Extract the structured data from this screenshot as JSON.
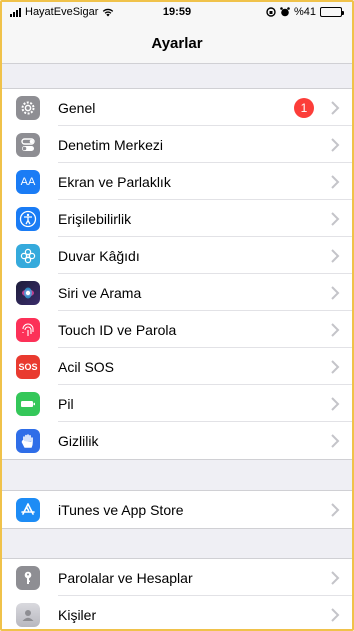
{
  "status_bar": {
    "carrier": "HayatEveSigar",
    "time": "19:59",
    "battery_text": "%41",
    "battery_level": 0.41
  },
  "nav": {
    "title": "Ayarlar"
  },
  "colors": {
    "general": "#8e8e93",
    "control_center": "#8e8e93",
    "display": "#1a7cf5",
    "accessibility": "#1a7cf5",
    "wallpaper": "#35aadc",
    "siri": "#1d1d3a",
    "touchid": "#fc3158",
    "sos": "#e93a2f",
    "battery": "#34c759",
    "privacy": "#2f6ee8",
    "appstore": "#1d8cf5",
    "passwords": "#8e8e93",
    "contacts": "#c7c7cc",
    "badge": "#fc3d39"
  },
  "groups": [
    {
      "items": [
        {
          "label": "Genel",
          "icon": "gear-icon",
          "badge": "1"
        },
        {
          "label": "Denetim Merkezi",
          "icon": "toggles-icon"
        },
        {
          "label": "Ekran ve Parlaklık",
          "icon": "aa-icon"
        },
        {
          "label": "Erişilebilirlik",
          "icon": "accessibility-icon"
        },
        {
          "label": "Duvar Kâğıdı",
          "icon": "flower-icon"
        },
        {
          "label": "Siri ve Arama",
          "icon": "siri-icon"
        },
        {
          "label": "Touch ID ve Parola",
          "icon": "fingerprint-icon"
        },
        {
          "label": "Acil SOS",
          "icon": "sos-icon",
          "icon_text": "SOS"
        },
        {
          "label": "Pil",
          "icon": "battery-icon"
        },
        {
          "label": "Gizlilik",
          "icon": "hand-icon"
        }
      ]
    },
    {
      "items": [
        {
          "label": "iTunes ve App Store",
          "icon": "app-store-icon"
        }
      ]
    },
    {
      "items": [
        {
          "label": "Parolalar ve Hesaplar",
          "icon": "key-icon"
        },
        {
          "label": "Kişiler",
          "icon": "contacts-icon"
        }
      ]
    }
  ]
}
